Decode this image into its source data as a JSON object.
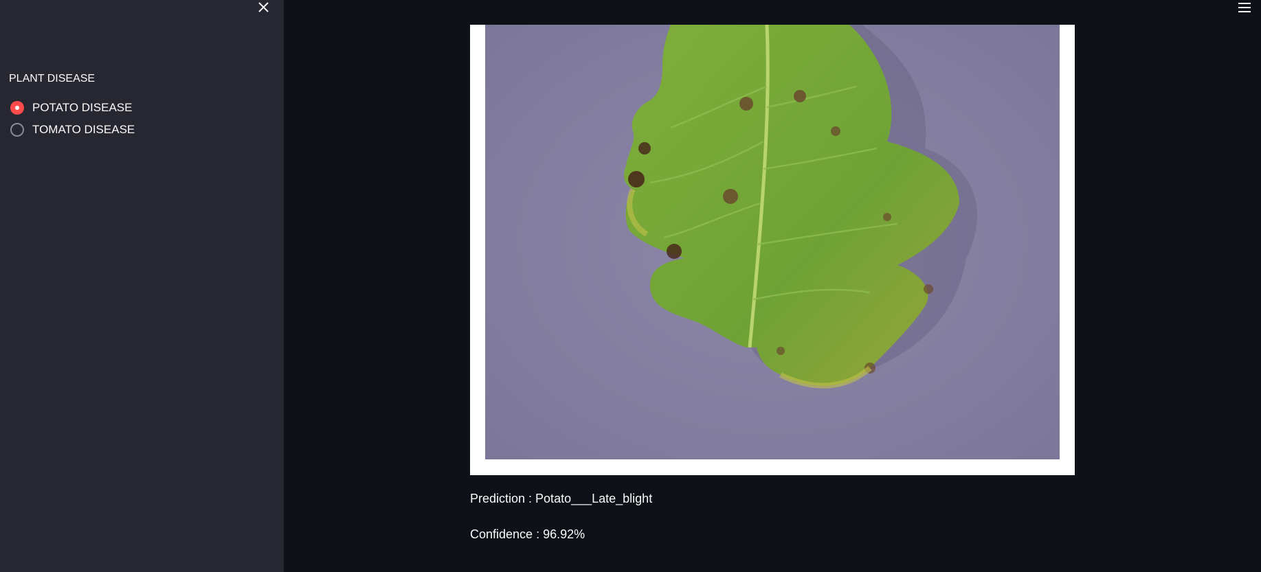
{
  "sidebar": {
    "close_icon": "close-icon",
    "radio_group": {
      "label": "PLANT DISEASE",
      "options": [
        {
          "label": "POTATO DISEASE",
          "selected": true
        },
        {
          "label": "TOMATO DISEASE",
          "selected": false
        }
      ]
    }
  },
  "header": {
    "menu_icon": "hamburger-menu-icon"
  },
  "main": {
    "prediction_text": "Prediction : Potato___Late_blight",
    "confidence_text": "Confidence : 96.92%"
  },
  "colors": {
    "app_background": "#0e1117",
    "sidebar_background": "#262730",
    "accent": "#ff4b4b",
    "text": "#fafafa"
  }
}
